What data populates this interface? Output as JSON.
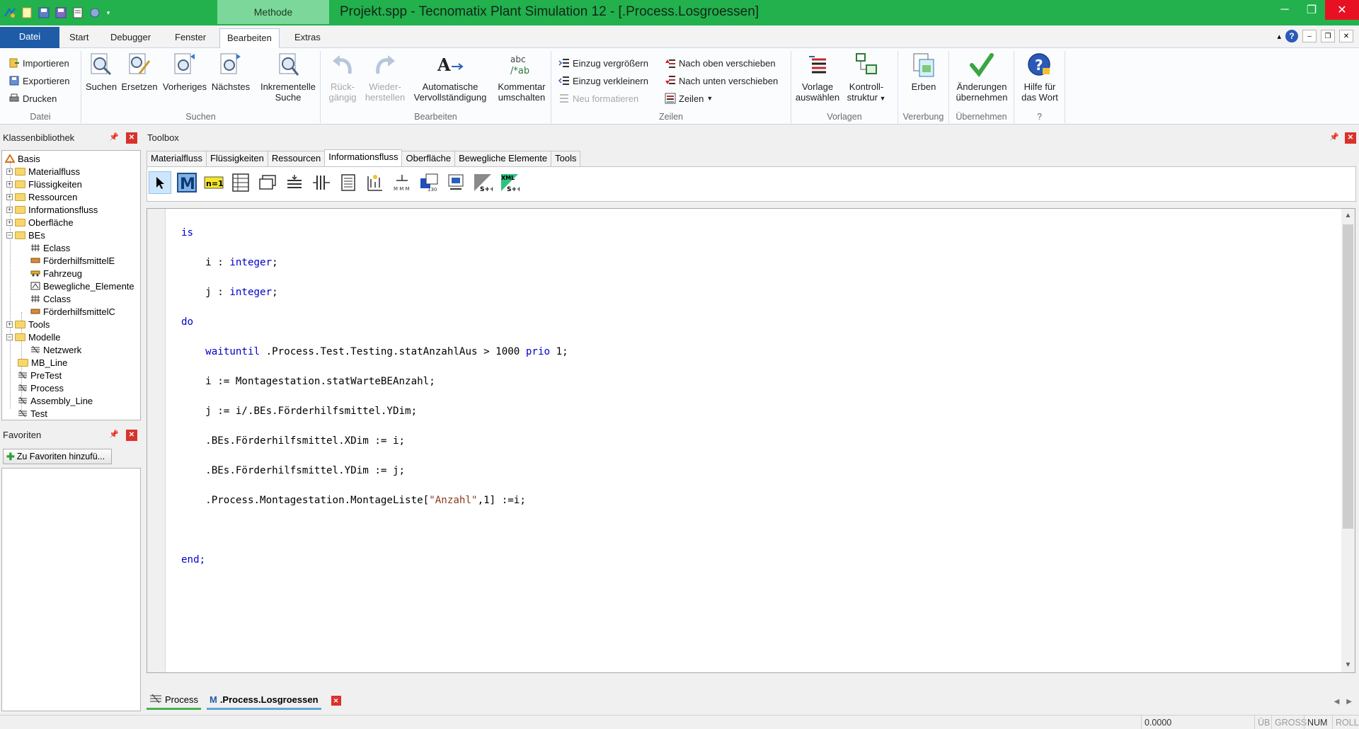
{
  "window": {
    "title": "Projekt.spp - Tecnomatix Plant Simulation 12 - [.Process.Losgroessen]",
    "context_tab": "Methode",
    "controls": [
      "minimize",
      "restore",
      "close"
    ]
  },
  "ribbon_tabs": [
    {
      "label": "Datei"
    },
    {
      "label": "Start"
    },
    {
      "label": "Debugger"
    },
    {
      "label": "Fenster"
    },
    {
      "label": "Bearbeiten"
    },
    {
      "label": "Extras"
    }
  ],
  "ribbon": {
    "datei": {
      "label": "Datei",
      "import": "Importieren",
      "export": "Exportieren",
      "print": "Drucken"
    },
    "suchen": {
      "label": "Suchen",
      "search": "Suchen",
      "replace": "Ersetzen",
      "previous": "Vorheriges",
      "next": "Nächstes",
      "incremental_1": "Inkrementelle",
      "incremental_2": "Suche"
    },
    "bearbeiten": {
      "label": "Bearbeiten",
      "undo_1": "Rück-",
      "undo_2": "gängig",
      "redo_1": "Wieder-",
      "redo_2": "herstellen",
      "autocomplete_1": "Automatische",
      "autocomplete_2": "Vervollständigung",
      "comment_1": "Kommentar",
      "comment_2": "umschalten"
    },
    "zeilen": {
      "label": "Zeilen",
      "indent_more": "Einzug vergrößern",
      "indent_less": "Einzug verkleinern",
      "reformat": "Neu formatieren",
      "move_up": "Nach oben verschieben",
      "move_down": "Nach unten verschieben",
      "lines": "Zeilen"
    },
    "vorlagen": {
      "label": "Vorlagen",
      "template_1": "Vorlage",
      "template_2": "auswählen",
      "control_1": "Kontroll-",
      "control_2": "struktur"
    },
    "vererbung": {
      "label": "Vererbung",
      "inherit": "Erben"
    },
    "uebernehmen": {
      "label": "Übernehmen",
      "apply_1": "Änderungen",
      "apply_2": "übernehmen"
    },
    "help": {
      "label": "?",
      "help_1": "Hilfe für",
      "help_2": "das Wort"
    }
  },
  "class_library": {
    "title": "Klassenbibliothek",
    "items": [
      {
        "label": "Basis",
        "icon": "basis-icon"
      },
      {
        "label": "Materialfluss",
        "icon": "folder-icon"
      },
      {
        "label": "Flüssigkeiten",
        "icon": "folder-icon"
      },
      {
        "label": "Ressourcen",
        "icon": "folder-icon"
      },
      {
        "label": "Informationsfluss",
        "icon": "folder-icon"
      },
      {
        "label": "Oberfläche",
        "icon": "folder-icon"
      },
      {
        "label": "BEs",
        "icon": "folder-open-icon"
      },
      {
        "label": "Eclass",
        "icon": "entity-icon"
      },
      {
        "label": "FörderhilfsmittelE",
        "icon": "container-icon"
      },
      {
        "label": "Fahrzeug",
        "icon": "vehicle-icon"
      },
      {
        "label": "Bewegliche_Elemente",
        "icon": "mu-icon"
      },
      {
        "label": "Cclass",
        "icon": "entity-icon"
      },
      {
        "label": "FörderhilfsmittelC",
        "icon": "container-icon"
      },
      {
        "label": "Tools",
        "icon": "folder-icon"
      },
      {
        "label": "Modelle",
        "icon": "folder-open-icon"
      },
      {
        "label": "Netzwerk",
        "icon": "frame-icon"
      },
      {
        "label": "MB_Line",
        "icon": "folder-icon"
      },
      {
        "label": "PreTest",
        "icon": "frame-icon"
      },
      {
        "label": "Process",
        "icon": "frame-icon"
      },
      {
        "label": "Assembly_Line",
        "icon": "frame-icon"
      },
      {
        "label": "Test",
        "icon": "frame-icon"
      }
    ]
  },
  "favorites": {
    "title": "Favoriten",
    "add_button": "Zu Favoriten hinzufü..."
  },
  "toolbox": {
    "title": "Toolbox",
    "tabs": [
      "Materialfluss",
      "Flüssigkeiten",
      "Ressourcen",
      "Informationsfluss",
      "Oberfläche",
      "Bewegliche Elemente",
      "Tools"
    ],
    "active_tab": "Informationsfluss",
    "icons": [
      "pointer-icon",
      "method-icon",
      "variable-icon",
      "table-file-icon",
      "card-file-icon",
      "stack-file-icon",
      "queue-file-icon",
      "trace-file-icon",
      "generator-icon",
      "interface-icon",
      "ftp-icon",
      "dde-icon",
      "socket-icon",
      "xml-icon"
    ]
  },
  "editor": {
    "lines": [
      "is",
      "    i : integer;",
      "    j : integer;",
      "do",
      "    waituntil .Process.Test.Testing.statAnzahlAus > 1000 prio 1;",
      "    i := Montagestation.statWarteBEAnzahl;",
      "    j := i/.BEs.Förderhilfsmittel.YDim;",
      "    .BEs.Förderhilfsmittel.XDim := i;",
      "    .BEs.Förderhilfsmittel.YDim := j;",
      "    .Process.Montagestation.MontageListe[\"Anzahl\",1] :=i;",
      "",
      "end;"
    ]
  },
  "doc_tabs": [
    {
      "label": "Process"
    },
    {
      "label": ".Process.Losgroessen"
    }
  ],
  "statusbar": {
    "value": "0.0000",
    "ub": "ÜB",
    "gross": "GROSS",
    "num": "NUM",
    "roll": "ROLL"
  }
}
